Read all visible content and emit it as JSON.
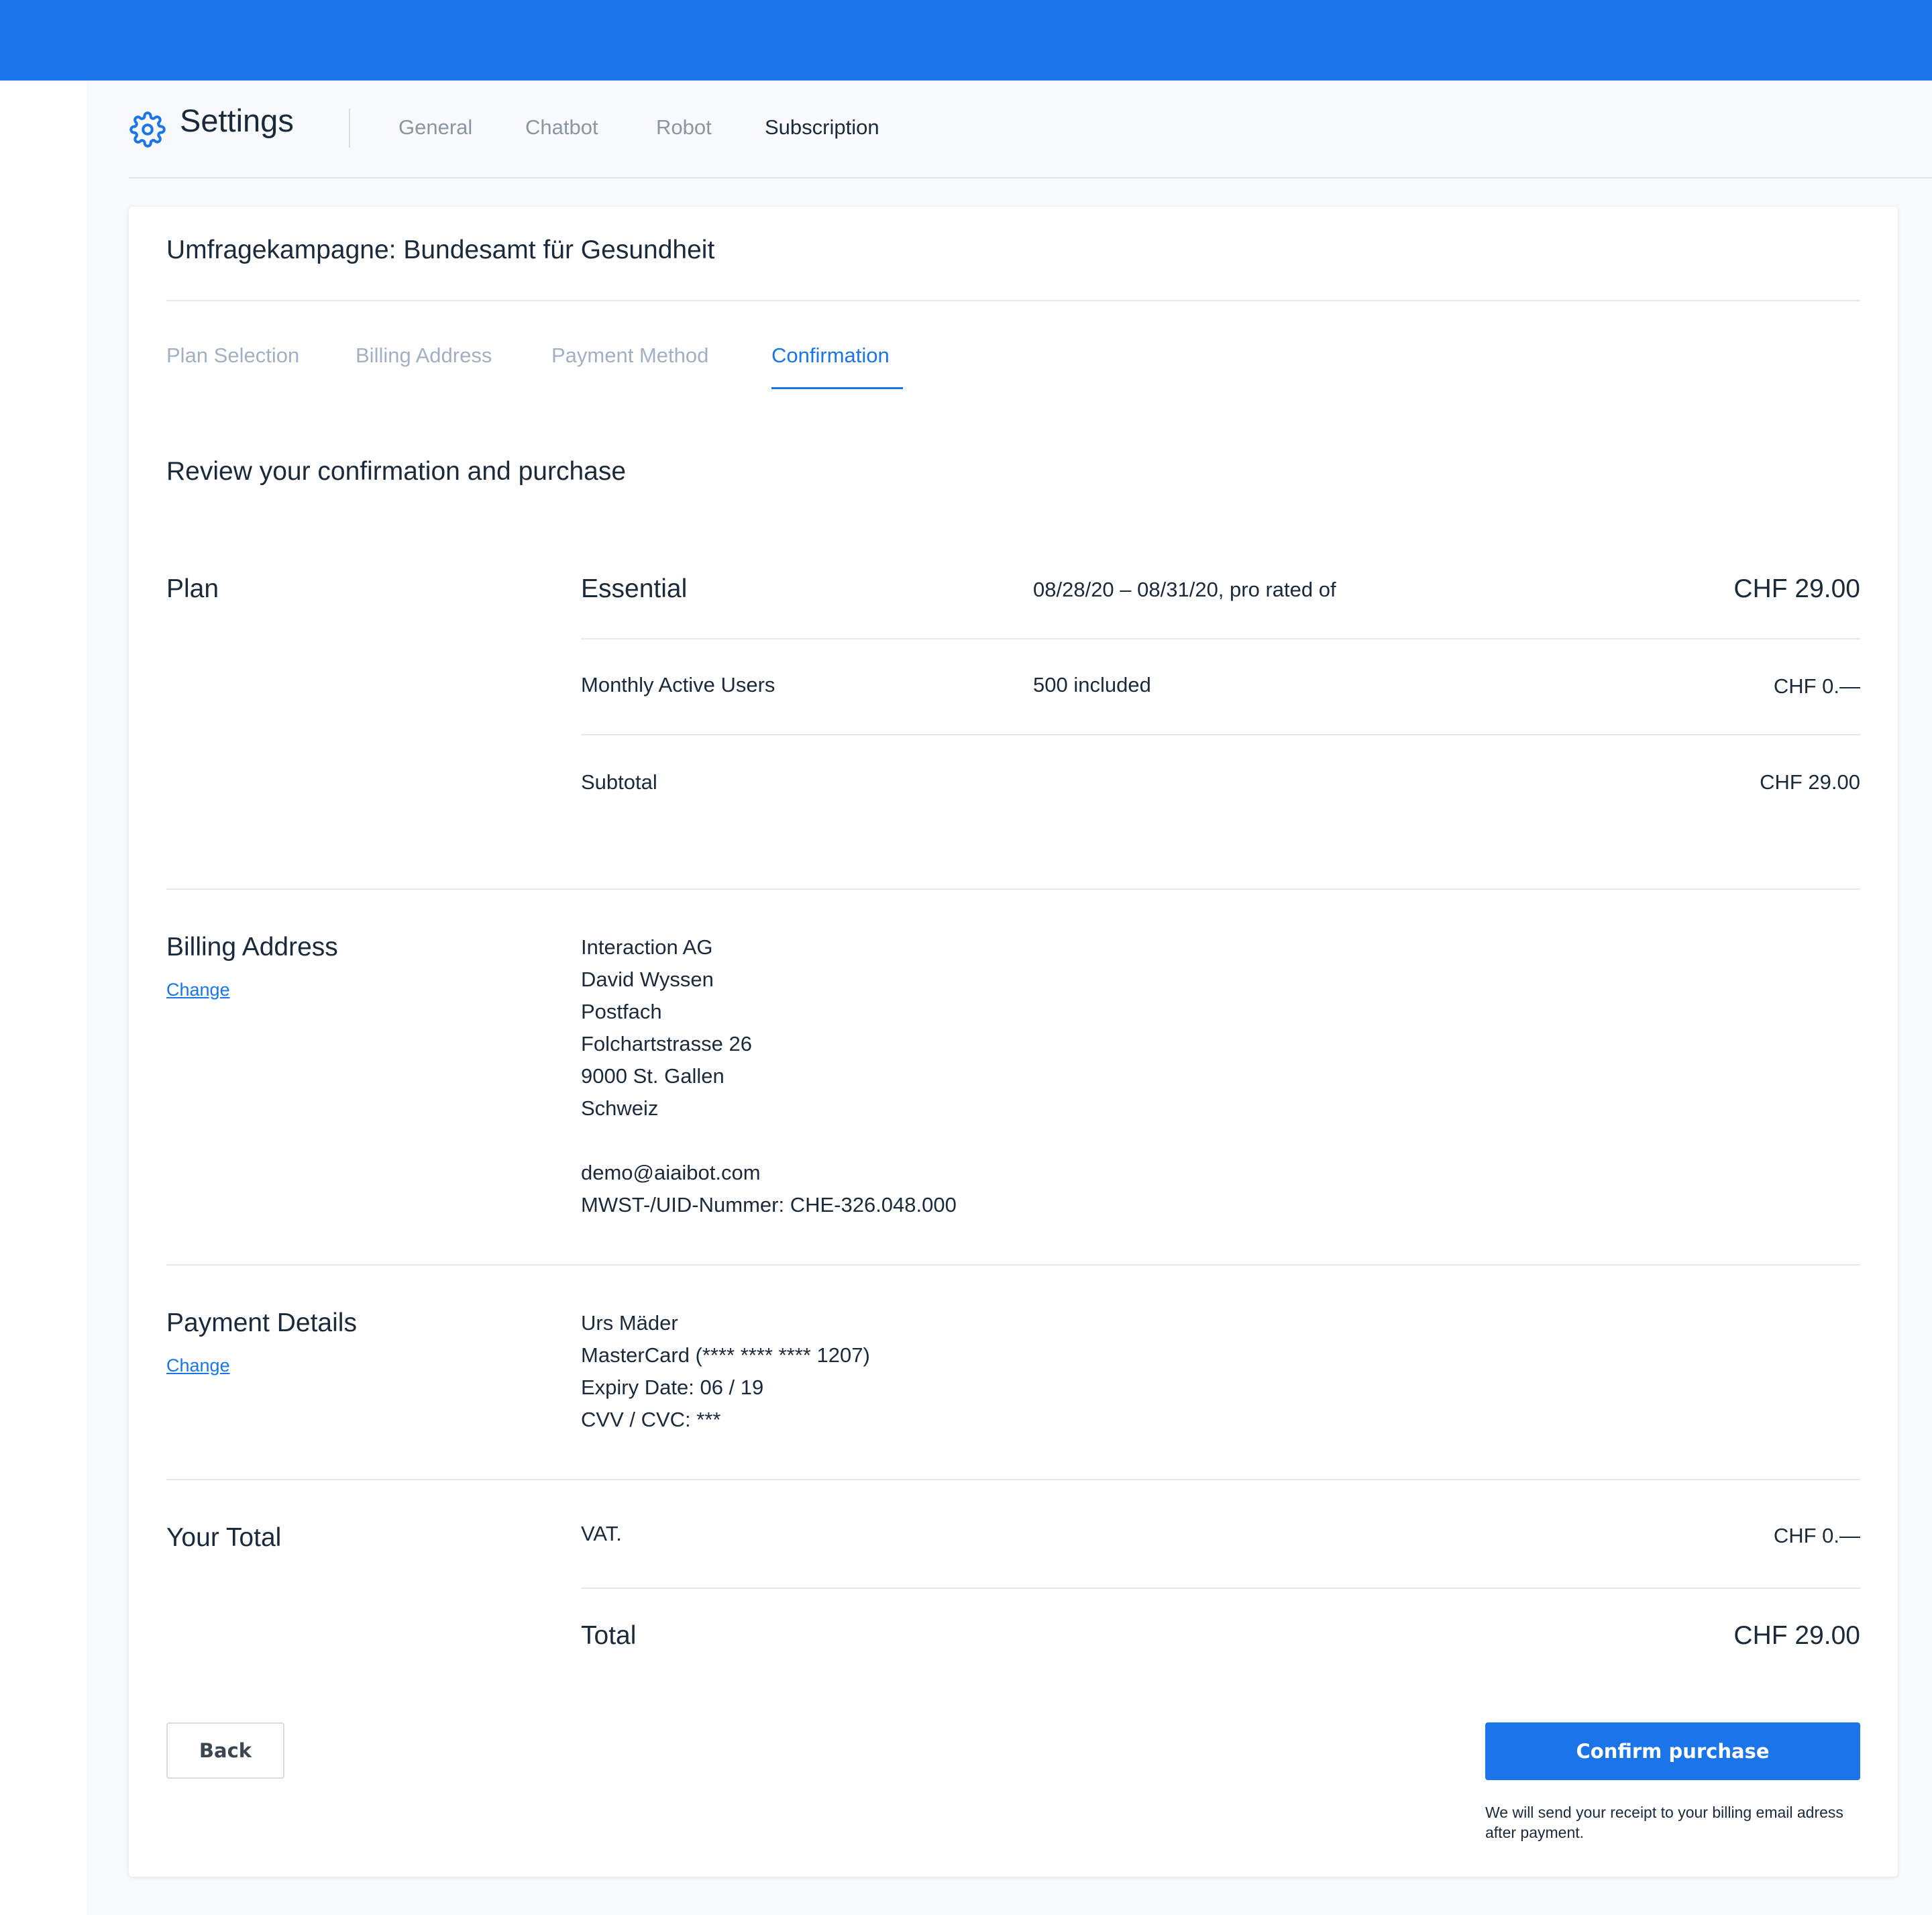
{
  "colors": {
    "brand": "#1b74e8",
    "text": "#1b2a3a",
    "muted": "#8a96a3"
  },
  "header": {
    "icon": "gear-icon",
    "title": "Settings",
    "tabs": [
      {
        "label": "General",
        "active": false
      },
      {
        "label": "Chatbot",
        "active": false
      },
      {
        "label": "Robot",
        "active": false
      },
      {
        "label": "Subscription",
        "active": true
      }
    ]
  },
  "card": {
    "title": "Umfragekampagne: Bundesamt für Gesundheit",
    "steps": [
      {
        "label": "Plan Selection",
        "active": false
      },
      {
        "label": "Billing Address",
        "active": false
      },
      {
        "label": "Payment Method",
        "active": false
      },
      {
        "label": "Confirmation",
        "active": true
      }
    ],
    "heading": "Review your confirmation and purchase",
    "plan": {
      "label": "Plan",
      "name": "Essential",
      "period": "08/28/20 – 08/31/20, pro rated of",
      "price": "CHF 29.00",
      "users_label": "Monthly Active Users",
      "users_value": "500 included",
      "users_price": "CHF 0.—",
      "subtotal_label": "Subtotal",
      "subtotal_price": "CHF 29.00"
    },
    "billing": {
      "label": "Billing Address",
      "change": "Change",
      "lines": [
        "Interaction AG",
        "David Wyssen",
        "Postfach",
        "Folchartstrasse 26",
        "9000 St. Gallen",
        "Schweiz"
      ],
      "email": "demo@aiaibot.com",
      "vat_id": "MWST-/UID-Nummer: CHE-326.048.000"
    },
    "payment": {
      "label": "Payment Details",
      "change": "Change",
      "lines": [
        "Urs Mäder",
        "MasterCard (**** **** **** 1207)",
        "Expiry Date: 06 / 19",
        "CVV / CVC: ***"
      ]
    },
    "total": {
      "label": "Your Total",
      "vat_label": "VAT.",
      "vat_price": "CHF 0.—",
      "total_label": "Total",
      "total_price": "CHF 29.00"
    },
    "actions": {
      "back": "Back",
      "confirm": "Confirm purchase",
      "note": "We will send your receipt to your billing email adress after payment."
    }
  }
}
